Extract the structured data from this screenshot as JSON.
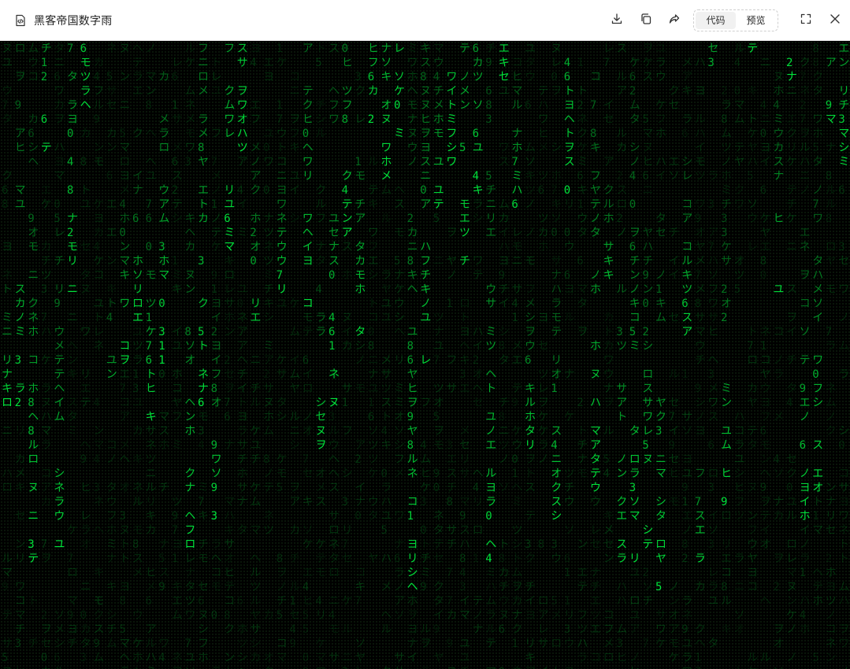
{
  "window": {
    "title": "黑客帝国数字雨",
    "app_icon": "code-file-icon"
  },
  "toolbar": {
    "download_icon": "download-icon",
    "copy_icon": "copy-icon",
    "share_icon": "share-icon",
    "tab_code": "代码",
    "tab_preview": "预览",
    "active_tab": "代码",
    "fullscreen_icon": "fullscreen-icon",
    "close_icon": "close-icon"
  },
  "preview": {
    "background_color": "#000000",
    "glyph_color": "#00ff41",
    "glyph_set": "アイウエオカキクケコサシスセソタチツテトナニヌネノハヒフヘホマミムメモヤユヨラリルレロワヲン0123456789",
    "column_count": 65
  }
}
